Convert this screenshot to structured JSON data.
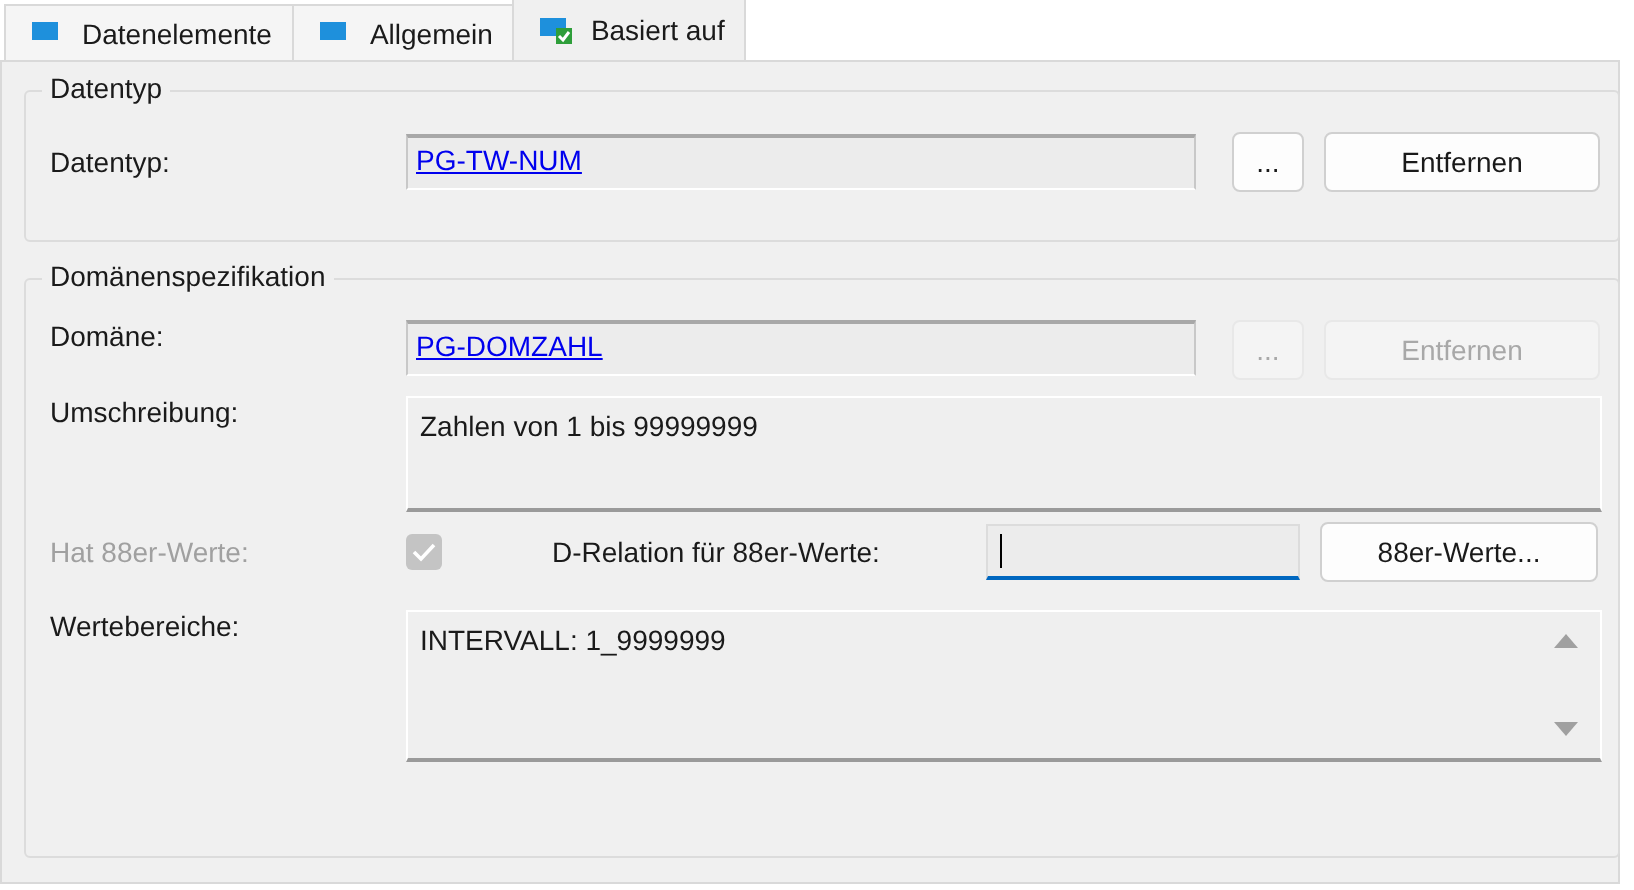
{
  "tabs": [
    {
      "label": "Datenelemente",
      "selected": false
    },
    {
      "label": "Allgemein",
      "selected": false
    },
    {
      "label": "Basiert auf",
      "selected": true
    }
  ],
  "datatype_group": {
    "title": "Datentyp",
    "label": "Datentyp:",
    "value": "PG-TW-NUM",
    "buttons": [
      {
        "label": "...",
        "disabled": false
      },
      {
        "label": "Entfernen",
        "disabled": false
      }
    ]
  },
  "domain_group": {
    "title": "Domänenspezifikation",
    "domain_label": "Domäne:",
    "domain_value": "PG-DOMZAHL",
    "buttons": [
      {
        "label": "...",
        "disabled": true
      },
      {
        "label": "Entfernen",
        "disabled": true
      }
    ],
    "description_label": "Umschreibung:",
    "description": "Zahlen von 1 bis 99999999",
    "has88_label": "Hat 88er-Werte:",
    "has88": {
      "checked": true,
      "disabled": true
    },
    "relation_label": "D-Relation für 88er-Werte:",
    "relation_field": {
      "focused": true
    },
    "values_button": "88er-Werte...",
    "ranges_label": "Wertebereiche:",
    "ranges": "INTERVALL: 1_9999999"
  }
}
